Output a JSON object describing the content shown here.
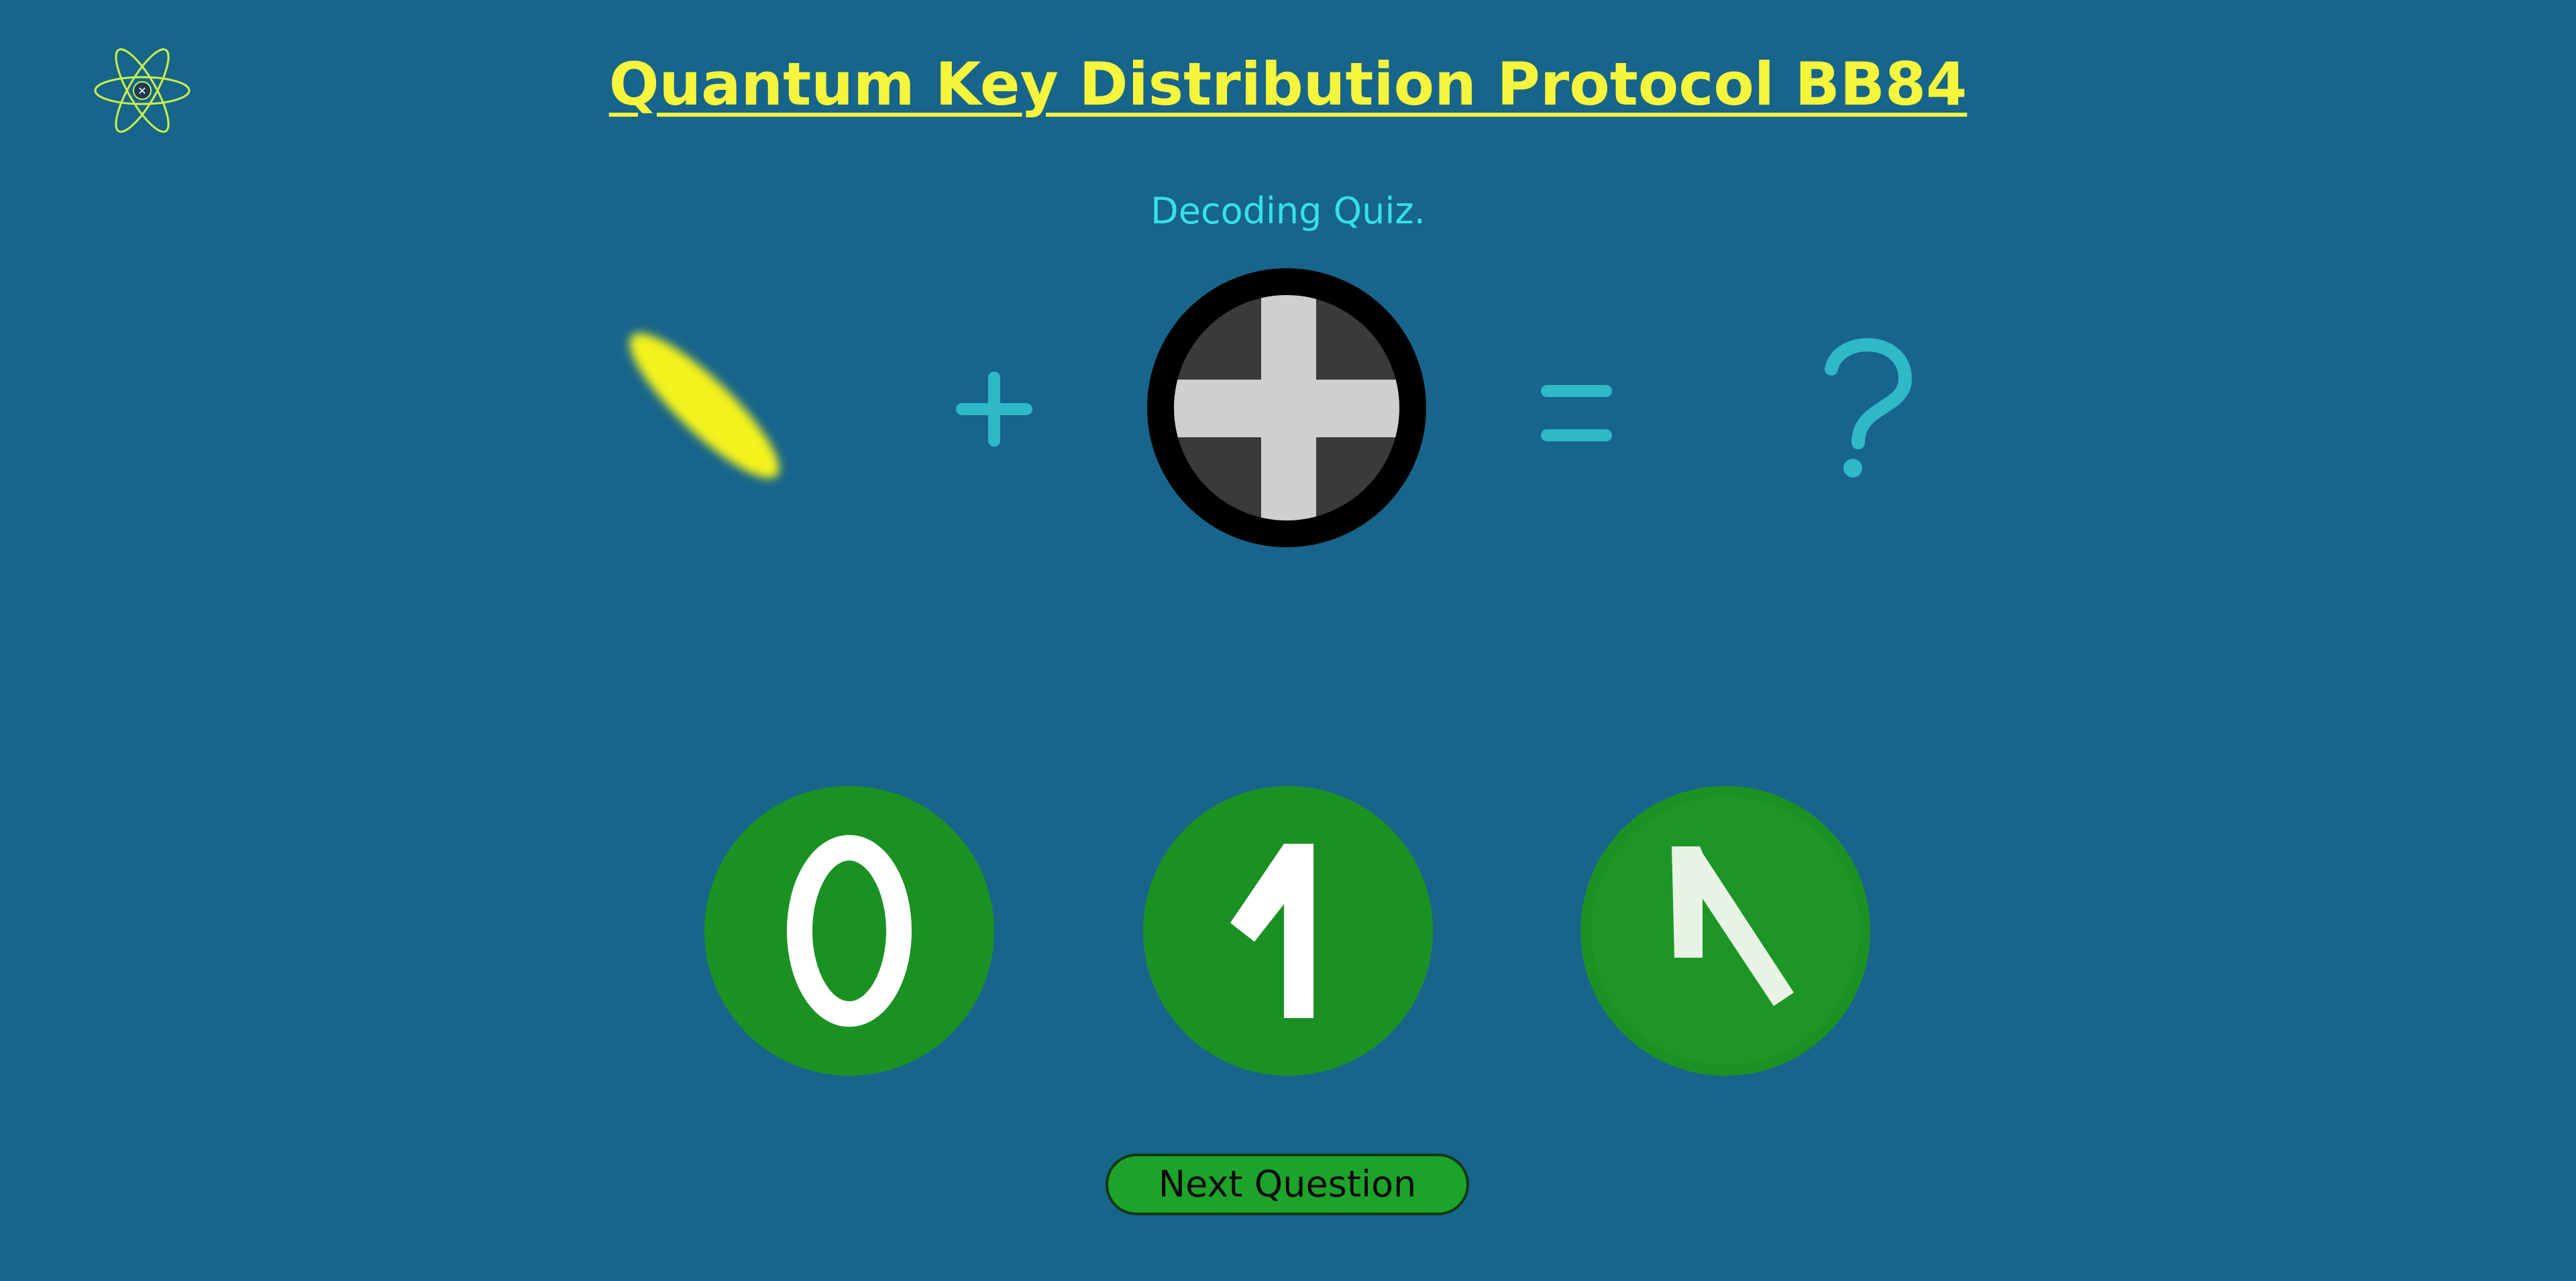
{
  "header": {
    "title": "Quantum Key Distribution Protocol BB84",
    "subtitle": "Decoding Quiz."
  },
  "icons": {
    "logo": "atom-icon",
    "photon": "diagonal-photon-icon",
    "plus": "plus-icon",
    "filter": "rectilinear-filter-icon",
    "equals": "equals-icon",
    "question": "question-mark-icon"
  },
  "answers": [
    {
      "label": "0",
      "icon": "digit-zero-icon"
    },
    {
      "label": "1",
      "icon": "digit-one-icon"
    },
    {
      "label": "random",
      "icon": "random-bit-icon"
    }
  ],
  "footer": {
    "next_label": "Next Question"
  },
  "colors": {
    "background": "#17658b",
    "title": "#f5f53d",
    "subtitle": "#35e0ea",
    "operator": "#2fb8c8",
    "photon": "#f2f21e",
    "answer_bg": "#1b9124",
    "button_bg": "#1ea32a"
  }
}
